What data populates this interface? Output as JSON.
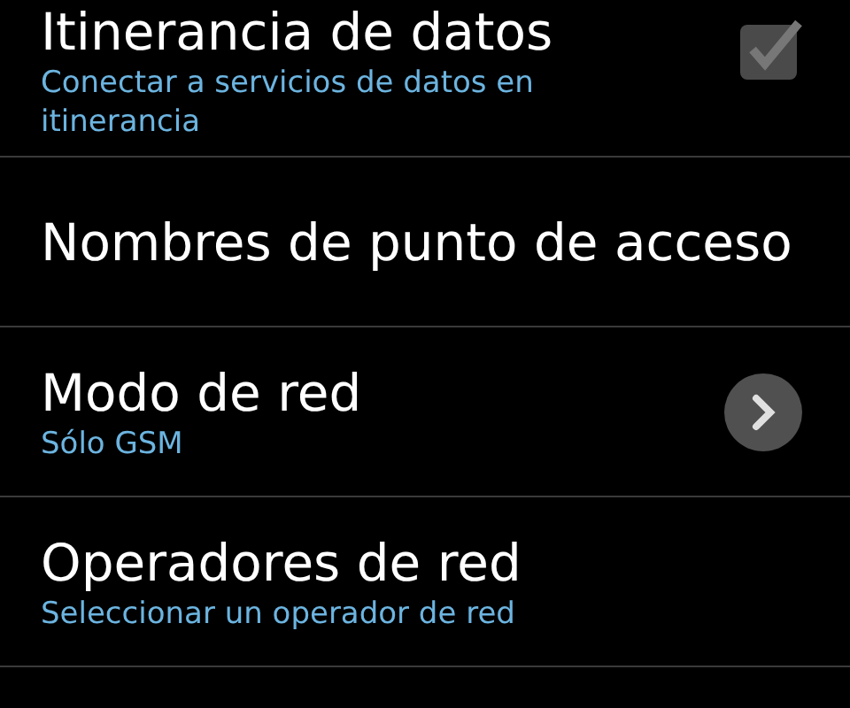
{
  "settings": [
    {
      "kind": "checkbox",
      "title": "Itinerancia de datos",
      "summary": "Conectar a servicios de datos en itinerancia",
      "checked": true,
      "disabled": true
    },
    {
      "kind": "plain",
      "title": "Nombres de punto de acceso"
    },
    {
      "kind": "arrow",
      "title": "Modo de red",
      "summary": "Sólo GSM"
    },
    {
      "kind": "plain",
      "title": "Operadores de red",
      "summary": "Seleccionar un operador de red"
    }
  ]
}
